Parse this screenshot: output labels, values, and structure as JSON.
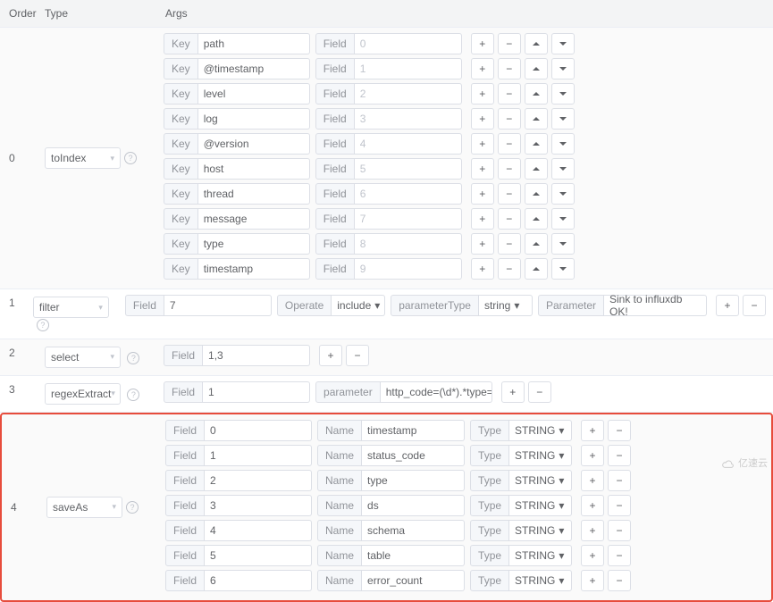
{
  "header": {
    "order": "Order",
    "type": "Type",
    "args": "Args"
  },
  "labels": {
    "key": "Key",
    "field": "Field",
    "operate": "Operate",
    "parameterType": "parameterType",
    "parameter": "Parameter",
    "parameterLower": "parameter",
    "name": "Name",
    "typeCol": "Type"
  },
  "row0": {
    "order": "0",
    "type": "toIndex",
    "keys": [
      {
        "key": "path",
        "field": "0"
      },
      {
        "key": "@timestamp",
        "field": "1"
      },
      {
        "key": "level",
        "field": "2"
      },
      {
        "key": "log",
        "field": "3"
      },
      {
        "key": "@version",
        "field": "4"
      },
      {
        "key": "host",
        "field": "5"
      },
      {
        "key": "thread",
        "field": "6"
      },
      {
        "key": "message",
        "field": "7"
      },
      {
        "key": "type",
        "field": "8"
      },
      {
        "key": "timestamp",
        "field": "9"
      }
    ]
  },
  "row1": {
    "order": "1",
    "type": "filter",
    "field": "7",
    "operate": "include",
    "paramType": "string",
    "paramValue": "Sink to influxdb OK!"
  },
  "row2": {
    "order": "2",
    "type": "select",
    "field": "1,3"
  },
  "row3": {
    "order": "3",
    "type": "regexExtract",
    "field": "1",
    "parameter": "http_code=(\\d*).*type=(.*),"
  },
  "row4": {
    "order": "4",
    "type": "saveAs",
    "items": [
      {
        "field": "0",
        "name": "timestamp",
        "type": "STRING"
      },
      {
        "field": "1",
        "name": "status_code",
        "type": "STRING"
      },
      {
        "field": "2",
        "name": "type",
        "type": "STRING"
      },
      {
        "field": "3",
        "name": "ds",
        "type": "STRING"
      },
      {
        "field": "4",
        "name": "schema",
        "type": "STRING"
      },
      {
        "field": "5",
        "name": "table",
        "type": "STRING"
      },
      {
        "field": "6",
        "name": "error_count",
        "type": "STRING"
      }
    ]
  },
  "watermark": "亿速云"
}
